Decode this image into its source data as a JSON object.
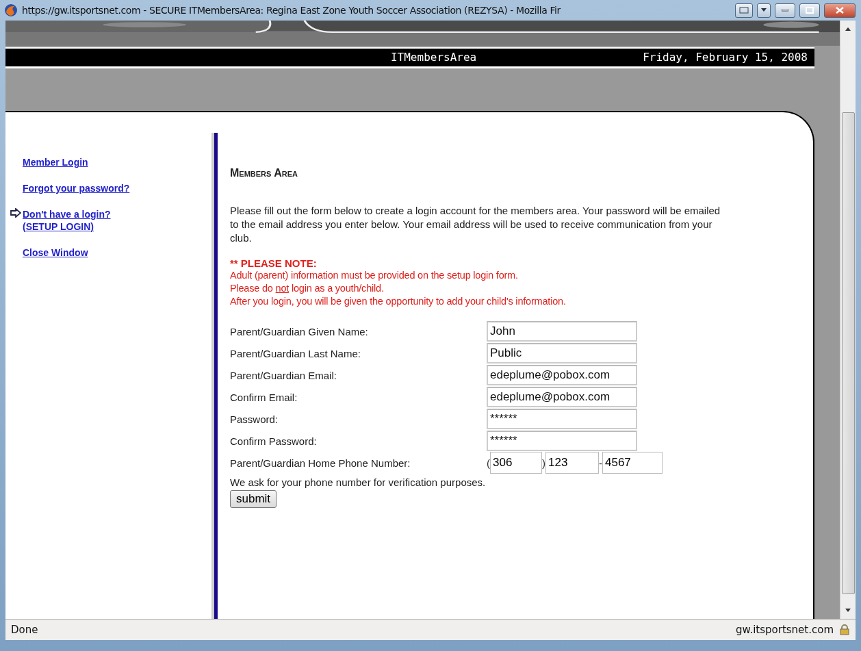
{
  "window": {
    "title": "https://gw.itsportsnet.com - SECURE ITMembersArea: Regina East Zone Youth Soccer Association (REZYSA) - Mozilla Fir"
  },
  "header": {
    "site": "ITMembersArea",
    "date": "Friday, February 15, 2008"
  },
  "sidebar": {
    "items": [
      {
        "label": "Member Login",
        "selected": false
      },
      {
        "label": "Forgot your password?",
        "selected": false
      },
      {
        "label": "Don't have a login? (SETUP LOGIN)",
        "selected": true
      },
      {
        "label": "Close Window",
        "selected": false
      }
    ]
  },
  "content": {
    "heading": "Members Area",
    "intro": "Please fill out the form below to create a login account for the members area. Your password will be emailed to the email address you enter below. Your email address will be used to receive communication from your club.",
    "note_title": "** PLEASE NOTE:",
    "note_lines": [
      {
        "before": "Adult (parent) information must be provided on the setup login form."
      },
      {
        "before": "Please do ",
        "underlined": "not",
        "after": " login as a youth/child."
      },
      {
        "before": "After you login, you will be given the opportunity to add your child's information."
      }
    ],
    "fields": [
      {
        "label": "Parent/Guardian Given Name:",
        "value": "John"
      },
      {
        "label": "Parent/Guardian Last Name:",
        "value": "Public"
      },
      {
        "label": "Parent/Guardian Email:",
        "value": "edeplume@pobox.com"
      },
      {
        "label": "Confirm Email:",
        "value": "edeplume@pobox.com"
      },
      {
        "label": "Password:",
        "value": "******"
      },
      {
        "label": "Confirm Password:",
        "value": "******"
      }
    ],
    "phone": {
      "label": "Parent/Guardian Home Phone Number:",
      "open": "(",
      "area": "306",
      "close": ")",
      "prefix": "123",
      "dash": "-",
      "line": "4567"
    },
    "phone_hint": "We ask for your phone number for verification purposes.",
    "submit": "submit"
  },
  "status_bar": {
    "text": "Done",
    "host": "gw.itsportsnet.com"
  }
}
